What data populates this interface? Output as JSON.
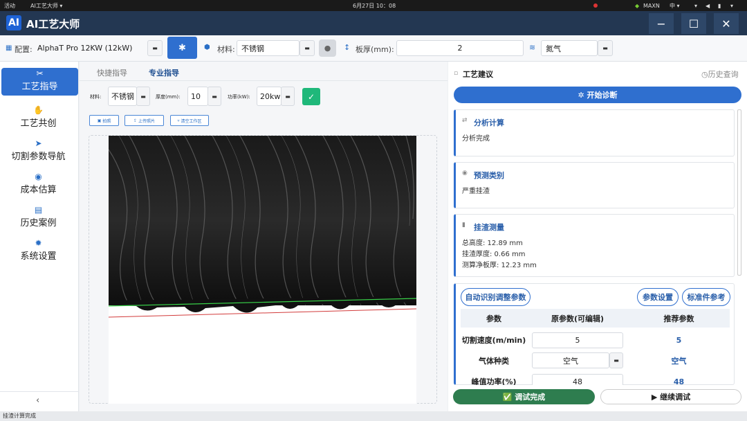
{
  "system_bar": {
    "activities": "活动",
    "app": "AI工艺大师 ▾",
    "datetime": "6月27日 10：08",
    "network": "MAXN",
    "lang": "中 ▾"
  },
  "title_bar": {
    "logo": "AI",
    "title": "AI工艺大师",
    "minimize": "−",
    "maximize": "☐",
    "close": "✕"
  },
  "config_bar": {
    "config_label": "配置:",
    "config_value": "AlphaT Pro 12KW (12kW)",
    "material_label": "材料:",
    "material_value": "不锈钢",
    "thickness_label": "板厚(mm):",
    "thickness_value": "2",
    "gas_value": "氮气"
  },
  "sidebar": {
    "items": [
      {
        "label": "工艺指导",
        "icon": "wrench-cross-icon"
      },
      {
        "label": "工艺共创",
        "icon": "handshake-icon"
      },
      {
        "label": "切割参数导航",
        "icon": "paper-plane-icon"
      },
      {
        "label": "成本估算",
        "icon": "coins-icon"
      },
      {
        "label": "历史案例",
        "icon": "document-icon"
      },
      {
        "label": "系统设置",
        "icon": "gear-icon"
      }
    ],
    "collapse": "‹"
  },
  "center": {
    "tabs": [
      "快捷指导",
      "专业指导"
    ],
    "material_label": "材料:",
    "material_value": "不锈钢",
    "thickness_label": "厚度(mm):",
    "thickness_value": "10",
    "power_label": "功率(kW):",
    "power_value": "20kw",
    "photo_btn": "拍照",
    "upload_btn": "上传照片",
    "clear_btn": "清空工作区"
  },
  "right": {
    "header": "工艺建议",
    "history": "历史查询",
    "diagnose_btn": "开始诊断",
    "cards": [
      {
        "title": "分析计算",
        "body": [
          "分析完成"
        ]
      },
      {
        "title": "预测类别",
        "body": [
          "严重挂渣"
        ]
      },
      {
        "title": "挂渣测量",
        "body": [
          "总高度: 12.89 mm",
          "挂渣厚度: 0.66 mm",
          "测算净板厚: 12.23 mm"
        ]
      }
    ],
    "auto_adjust": "自动识别调整参数",
    "param_settings": "参数设置",
    "standard_ref": "标准件参考",
    "table": {
      "headers": [
        "参数",
        "原参数(可编辑)",
        "推荐参数"
      ],
      "rows": [
        {
          "name": "切割速度(m/min)",
          "orig": "5",
          "rec": "5"
        },
        {
          "name": "气体种类",
          "orig": "空气",
          "rec": "空气"
        },
        {
          "name": "峰值功率(%)",
          "orig": "48",
          "rec": "48"
        }
      ]
    },
    "done_btn": "✅ 调试完成",
    "continue_btn": "▶ 继续调试"
  },
  "status": "挂渣计算完成",
  "colors": {
    "primary": "#2f6fcf",
    "titlebar": "#233752",
    "success": "#2e7d4f",
    "check": "#1fb87a"
  }
}
